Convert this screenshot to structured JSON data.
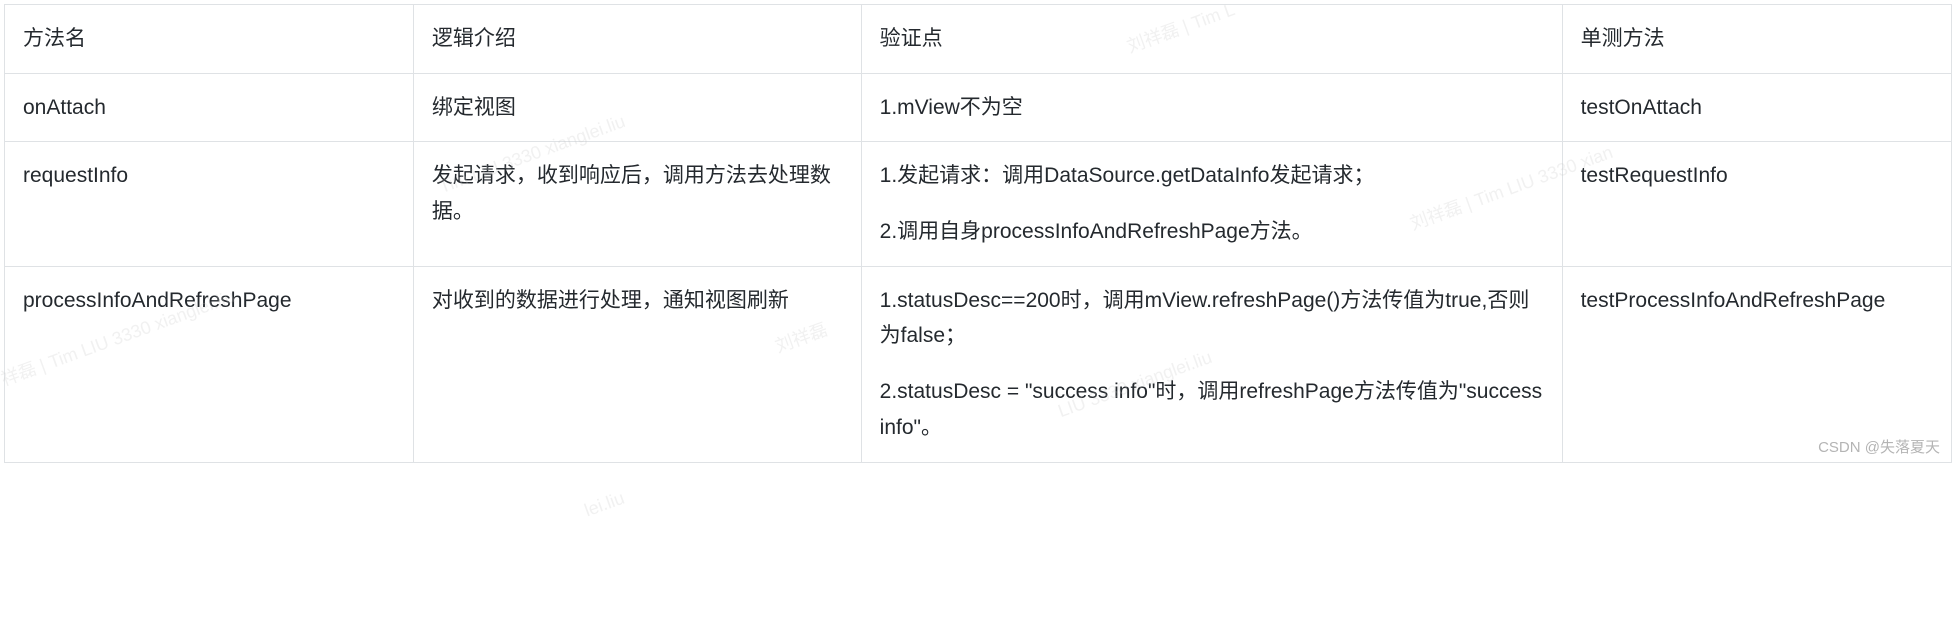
{
  "table": {
    "headers": [
      "方法名",
      "逻辑介绍",
      "验证点",
      "单测方法"
    ],
    "rows": [
      {
        "method": "onAttach",
        "logic": "绑定视图",
        "verify": [
          "1.mView不为空"
        ],
        "test": "testOnAttach"
      },
      {
        "method": "requestInfo",
        "logic": "发起请求，收到响应后，调用方法去处理数据。",
        "verify": [
          "1.发起请求：调用DataSource.getDataInfo发起请求；",
          "2.调用自身processInfoAndRefreshPage方法。"
        ],
        "test": "testRequestInfo"
      },
      {
        "method": "processInfoAndRefreshPage",
        "logic": "对收到的数据进行处理，通知视图刷新",
        "verify": [
          "1.statusDesc==200时，调用mView.refreshPage()方法传值为true,否则为false；",
          "2.statusDesc = \"success info\"时，调用refreshPage方法传值为\"success info\"。"
        ],
        "test": "testProcessInfoAndRefreshPage"
      }
    ]
  },
  "watermarks": {
    "text1": "Tim LIU 3330 xianglei.liu",
    "text2": "刘祥磊 | Tim L",
    "text3": "刘祥磊 | Tim LIU 3330 xian",
    "text4": "祥磊 | Tim LIU 3330 xianglei.liu",
    "text5": "刘祥磊",
    "text6": "lei.liu",
    "text7": "LIU 3330 xianglei.liu"
  },
  "csdn": "CSDN @失落夏天"
}
